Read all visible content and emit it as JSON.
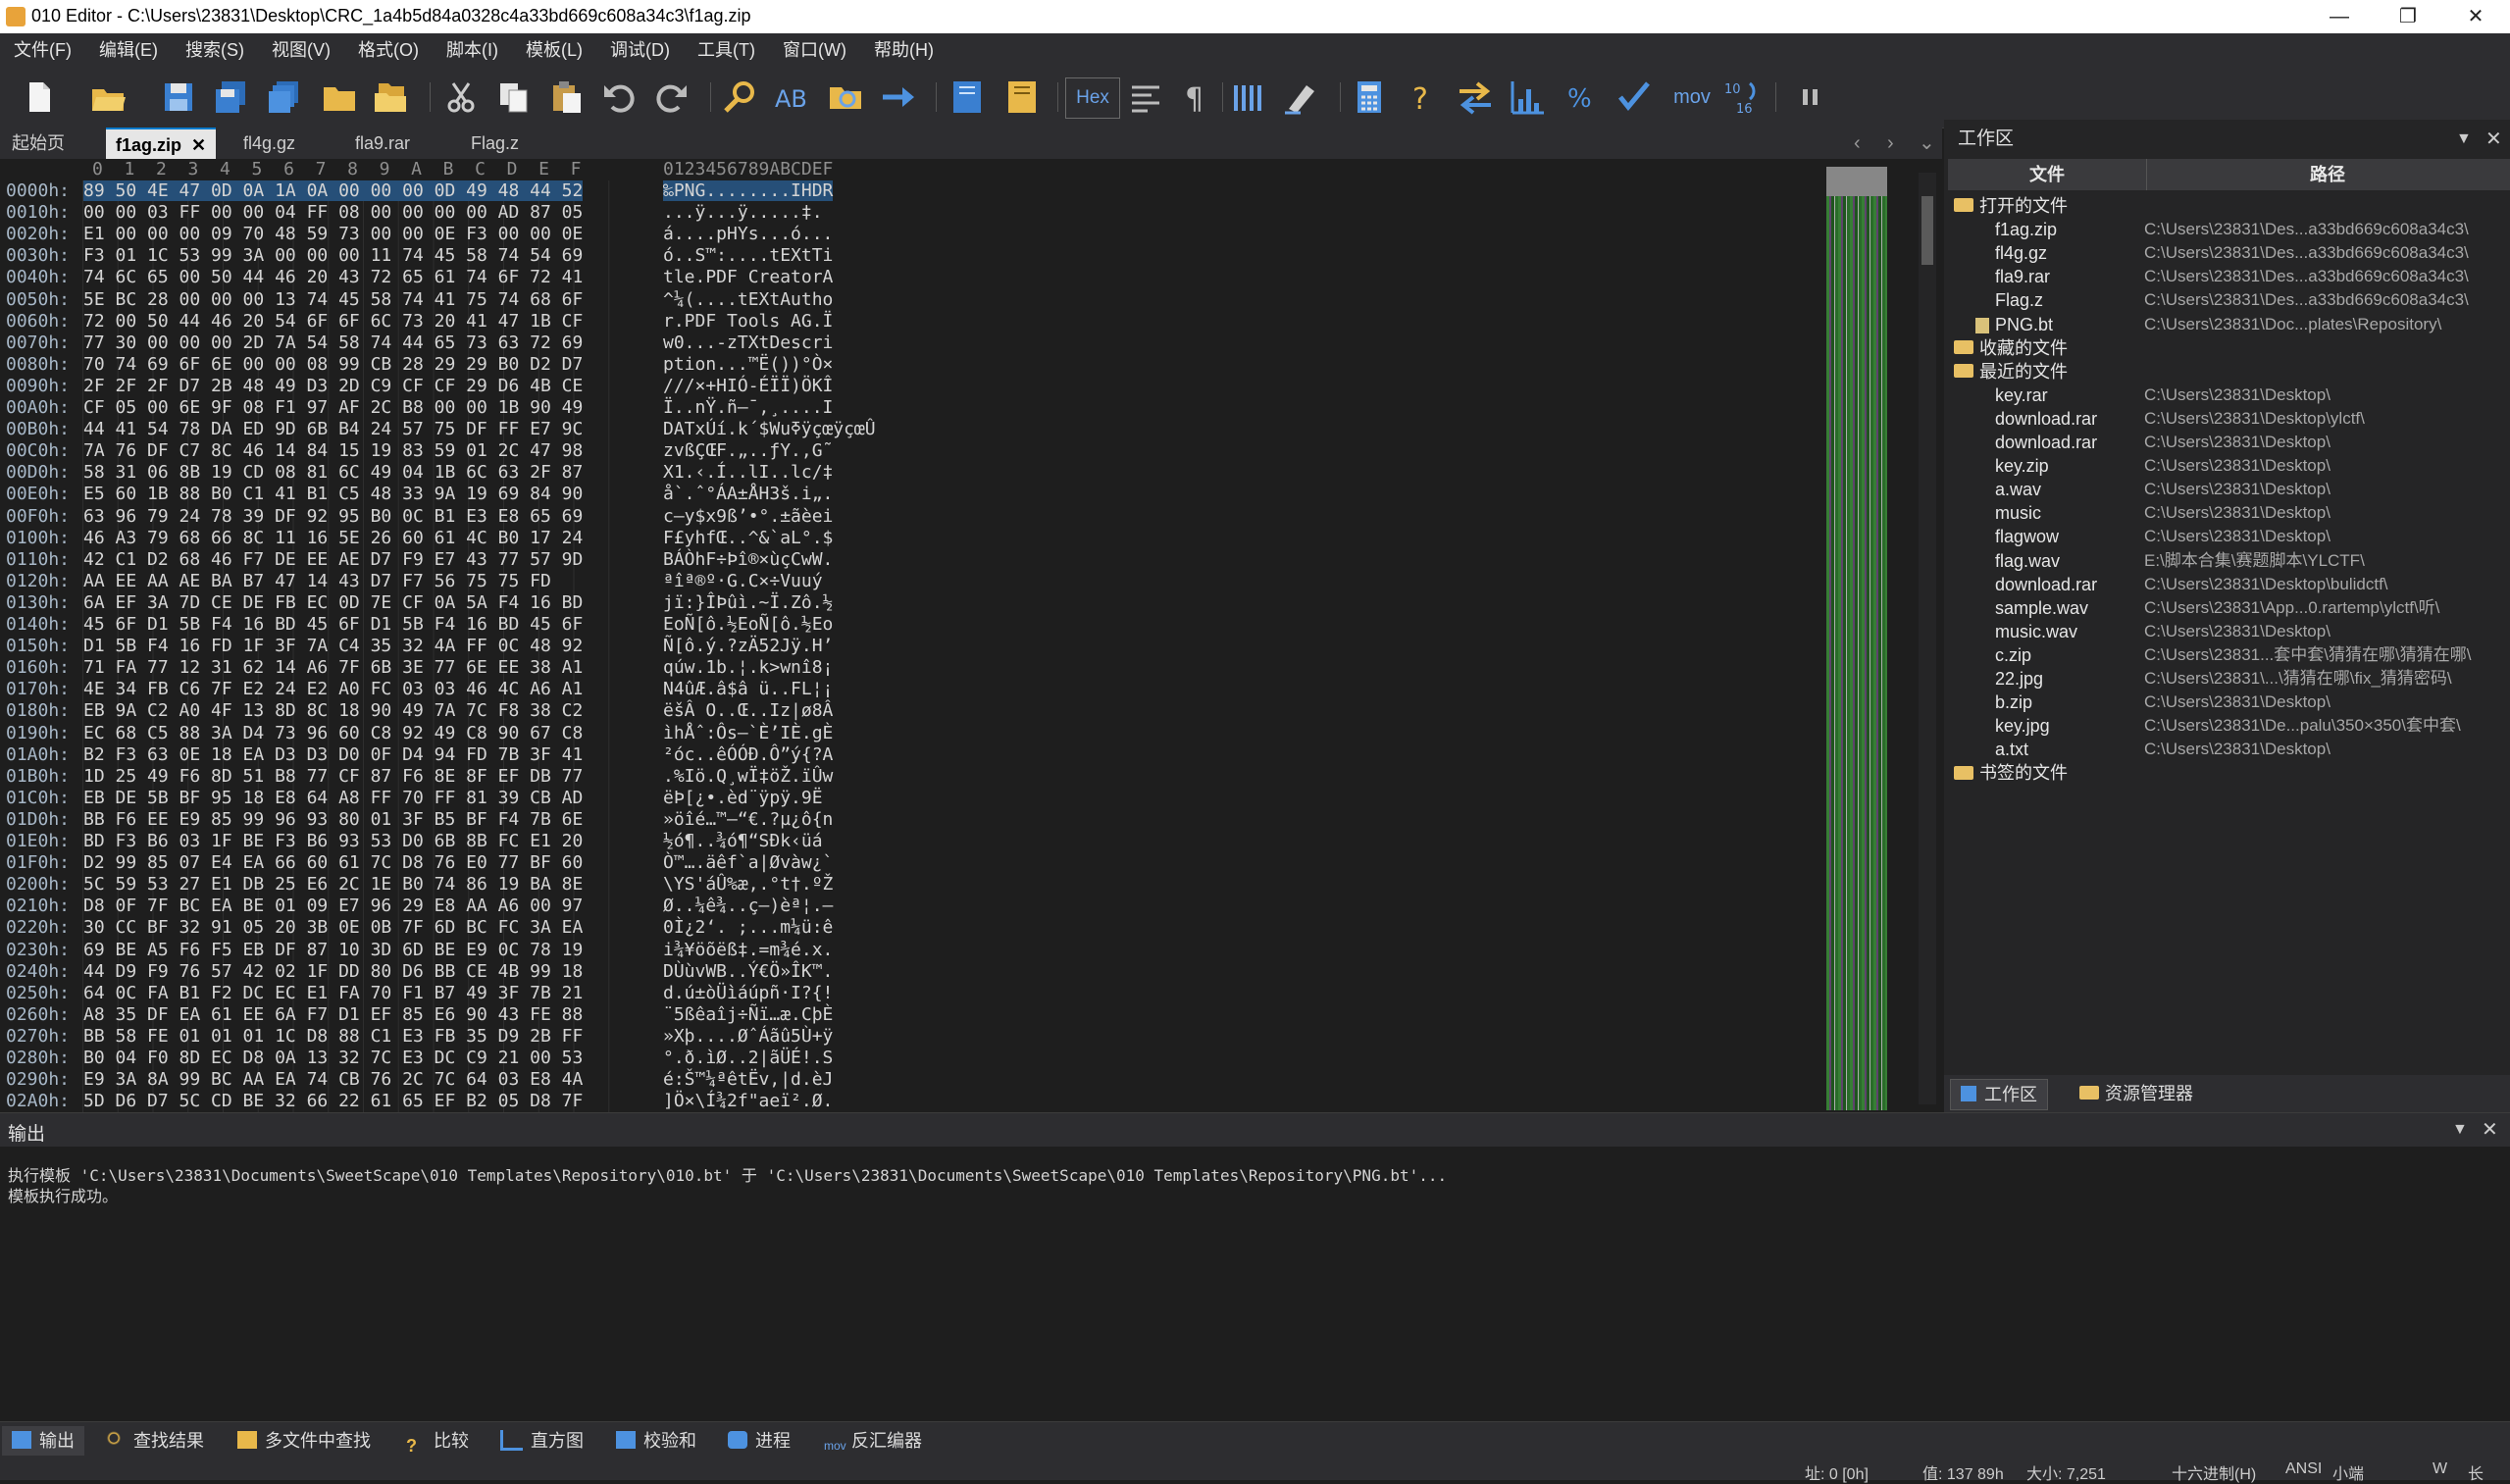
{
  "window": {
    "title": "010 Editor - C:\\Users\\23831\\Desktop\\CRC_1a4b5d84a0328c4a33bd669c608a34c3\\f1ag.zip",
    "minimize": "—",
    "maximize": "❐",
    "close": "✕"
  },
  "menu": [
    "文件(F)",
    "编辑(E)",
    "搜索(S)",
    "视图(V)",
    "格式(O)",
    "脚本(I)",
    "模板(L)",
    "调试(D)",
    "工具(T)",
    "窗口(W)",
    "帮助(H)"
  ],
  "toolbar": {
    "hex_label": "Hex",
    "mov_label": "mov",
    "icons": [
      "new-file-icon",
      "open-file-icon",
      "save-icon",
      "save-as-icon",
      "save-all-icon",
      "open-folder-icon",
      "open-folder-2-icon",
      "cut-icon",
      "copy-icon",
      "paste-icon",
      "undo-icon",
      "redo-icon",
      "find-icon",
      "replace-icon",
      "find-in-files-icon",
      "goto-icon",
      "run-script-icon",
      "run-template-icon",
      "hex-toggle",
      "edit-as-icon",
      "pilcrow-icon",
      "columns-icon",
      "highlight-icon",
      "calculator-icon",
      "help-icon",
      "compare-icon",
      "histogram-icon",
      "percent-icon",
      "checksum-icon",
      "mov-label",
      "base-convert-icon",
      "pause-icon"
    ]
  },
  "tabs": {
    "start": "起始页",
    "files": [
      "f1ag.zip",
      "fl4g.gz",
      "fla9.rar",
      "Flag.z"
    ],
    "active_index": 0,
    "close_glyph": "✕"
  },
  "hex": {
    "col_header": "0  1  2  3  4  5  6  7  8  9  A  B  C  D  E  F",
    "ascii_header": "0123456789ABCDEF",
    "rows": [
      {
        "addr": "0000h:",
        "bytes": "89 50 4E 47 0D 0A 1A 0A 00 00 00 0D 49 48 44 52",
        "ascii": "‰PNG........IHDR"
      },
      {
        "addr": "0010h:",
        "bytes": "00 00 03 FF 00 00 04 FF 08 00 00 00 00 AD 87 05",
        "ascii": "...ÿ...ÿ.....­‡."
      },
      {
        "addr": "0020h:",
        "bytes": "E1 00 00 00 09 70 48 59 73 00 00 0E F3 00 00 0E",
        "ascii": "á....pHYs...ó..."
      },
      {
        "addr": "0030h:",
        "bytes": "F3 01 1C 53 99 3A 00 00 00 11 74 45 58 74 54 69",
        "ascii": "ó..S™:....tEXtTi"
      },
      {
        "addr": "0040h:",
        "bytes": "74 6C 65 00 50 44 46 20 43 72 65 61 74 6F 72 41",
        "ascii": "tle.PDF CreatorA"
      },
      {
        "addr": "0050h:",
        "bytes": "5E BC 28 00 00 00 13 74 45 58 74 41 75 74 68 6F",
        "ascii": "^¼(....tEXtAutho"
      },
      {
        "addr": "0060h:",
        "bytes": "72 00 50 44 46 20 54 6F 6F 6C 73 20 41 47 1B CF",
        "ascii": "r.PDF Tools AG.Ï"
      },
      {
        "addr": "0070h:",
        "bytes": "77 30 00 00 00 2D 7A 54 58 74 44 65 73 63 72 69",
        "ascii": "w0...-zTXtDescri"
      },
      {
        "addr": "0080h:",
        "bytes": "70 74 69 6F 6E 00 00 08 99 CB 28 29 29 B0 D2 D7",
        "ascii": "ption...™Ë())°Ò×"
      },
      {
        "addr": "0090h:",
        "bytes": "2F 2F 2F D7 2B 48 49 D3 2D C9 CF CF 29 D6 4B CE",
        "ascii": "///×+HIÓ-ÉÏÏ)ÖKÎ"
      },
      {
        "addr": "00A0h:",
        "bytes": "CF 05 00 6E 9F 08 F1 97 AF 2C B8 00 00 1B 90 49",
        "ascii": "Ï..nŸ.ñ—¯,¸....I"
      },
      {
        "addr": "00B0h:",
        "bytes": "44 41 54 78 DA ED 9D 6B B4 24 57 75 DF FF E7 9C",
        "ascii": "DATxÚí.k´$WuߧÿçœÿçœÛ"
      },
      {
        "addr": "00C0h:",
        "bytes": "7A 76 DF C7 8C 46 14 84 15 19 83 59 01 2C 47 98",
        "ascii": "zvßÇŒF.„..ƒY.,G˜"
      },
      {
        "addr": "00D0h:",
        "bytes": "58 31 06 8B 19 CD 08 81 6C 49 04 1B 6C 63 2F 87",
        "ascii": "X1.‹.Í..lI..lc/‡"
      },
      {
        "addr": "00E0h:",
        "bytes": "E5 60 1B 88 B0 C1 41 B1 C5 48 33 9A 19 69 84 90",
        "ascii": "å`.ˆ°ÁA±ÅH3š.i„."
      },
      {
        "addr": "00F0h:",
        "bytes": "63 96 79 24 78 39 DF 92 95 B0 0C B1 E3 E8 65 69",
        "ascii": "c–y$x9ß’•°.±ãèei"
      },
      {
        "addr": "0100h:",
        "bytes": "46 A3 79 68 66 8C 11 16 5E 26 60 61 4C B0 17 24",
        "ascii": "F£yhfŒ..^&`aL°.$"
      },
      {
        "addr": "0110h:",
        "bytes": "42 C1 D2 68 46 F7 DE EE AE D7 F9 E7 43 77 57 9D",
        "ascii": "BÁÒhF÷Þî®×ùçCwW."
      },
      {
        "addr": "0120h:",
        "bytes": "AA EE AA AE BA B7 47 14 43 D7 F7 56 75 75 FD",
        "ascii": "ªîª®º·G.C×÷Vuuý"
      },
      {
        "addr": "0130h:",
        "bytes": "6A EF 3A 7D CE DE FB EC 0D 7E CF 0A 5A F4 16 BD",
        "ascii": "jï:}ÎÞûì.~Ï.Zô.½"
      },
      {
        "addr": "0140h:",
        "bytes": "45 6F D1 5B F4 16 BD 45 6F D1 5B F4 16 BD 45 6F",
        "ascii": "EoÑ[ô.½EoÑ[ô.½Eo"
      },
      {
        "addr": "0150h:",
        "bytes": "D1 5B F4 16 FD 1F 3F 7A C4 35 32 4A FF 0C 48 92",
        "ascii": "Ñ[ô.ý.?zÄ52Jÿ.H’"
      },
      {
        "addr": "0160h:",
        "bytes": "71 FA 77 12 31 62 14 A6 7F 6B 3E 77 6E EE 38 A1",
        "ascii": "qúw.1b.¦.k>wnî8¡"
      },
      {
        "addr": "0170h:",
        "bytes": "4E 34 FB C6 7F E2 24 E2 A0 FC 03 03 46 4C A6 A1",
        "ascii": "N4ûÆ.â$â ü..FL¦¡"
      },
      {
        "addr": "0180h:",
        "bytes": "EB 9A C2 A0 4F 13 8D 8C 18 90 49 7A 7C F8 38 C2",
        "ascii": "ëšÂ O..Œ..Iz|ø8Â"
      },
      {
        "addr": "0190h:",
        "bytes": "EC 68 C5 88 3A D4 73 96 60 C8 92 49 C8 90 67 C8",
        "ascii": "ìhÅˆ:Ôs–`È’IÈ.gÈ"
      },
      {
        "addr": "01A0h:",
        "bytes": "B2 F3 63 0E 18 EA D3 D3 D0 0F D4 94 FD 7B 3F 41",
        "ascii": "²óc..êÓÓÐ.Ô”ý{?A"
      },
      {
        "addr": "01B0h:",
        "bytes": "1D 25 49 F6 8D 51 B8 77 CF 87 F6 8E 8F EF DB 77",
        "ascii": ".%Iö.Q¸wÏ‡öŽ.ïÛw"
      },
      {
        "addr": "01C0h:",
        "bytes": "EB DE 5B BF 95 18 E8 64 A8 FF 70 FF 81 39 CB AD",
        "ascii": "ëÞ[¿•.èd¨ÿpÿ.9Ë­"
      },
      {
        "addr": "01D0h:",
        "bytes": "BB F6 EE E9 85 99 96 93 80 01 3F B5 BF F4 7B 6E",
        "ascii": "»öîé…™–“€.?µ¿ô{n"
      },
      {
        "addr": "01E0h:",
        "bytes": "BD F3 B6 03 1F BE F3 B6 93 53 D0 6B 8B FC E1 20",
        "ascii": "½ó¶..¾ó¶“SÐk‹üá "
      },
      {
        "addr": "01F0h:",
        "bytes": "D2 99 85 07 E4 EA 66 60 61 7C D8 76 E0 77 BF 60",
        "ascii": "Ò™….äêf`a|Øvàw¿`"
      },
      {
        "addr": "0200h:",
        "bytes": "5C 59 53 27 E1 DB 25 E6 2C 1E B0 74 86 19 BA 8E",
        "ascii": "\\YS'áÛ%æ,.°t†.ºŽ"
      },
      {
        "addr": "0210h:",
        "bytes": "D8 0F 7F BC EA BE 01 09 E7 96 29 E8 AA A6 00 97",
        "ascii": "Ø..¼ê¾..ç–)èª¦.—"
      },
      {
        "addr": "0220h:",
        "bytes": "30 CC BF 32 91 05 20 3B 0E 0B 7F 6D BC FC 3A EA",
        "ascii": "0Ì¿2‘. ;...m¼ü:ê"
      },
      {
        "addr": "0230h:",
        "bytes": "69 BE A5 F6 F5 EB DF 87 10 3D 6D BE E9 0C 78 19",
        "ascii": "i¾¥öõëß‡.=m¾é.x."
      },
      {
        "addr": "0240h:",
        "bytes": "44 D9 F9 76 57 42 02 1F DD 80 D6 BB CE 4B 99 18",
        "ascii": "DÙùvWB..Ý€Ö»ÎK™."
      },
      {
        "addr": "0250h:",
        "bytes": "64 0C FA B1 F2 DC EC E1 FA 70 F1 B7 49 3F 7B 21",
        "ascii": "d.ú±òÜìáúpñ·I?{!"
      },
      {
        "addr": "0260h:",
        "bytes": "A8 35 DF EA 61 EE 6A F7 D1 EF 85 E6 90 43 FE 88",
        "ascii": "¨5ßêaîj÷Ñï…æ.CþÈ"
      },
      {
        "addr": "0270h:",
        "bytes": "BB 58 FE 01 01 01 1C D8 88 C1 E3 FB 35 D9 2B FF",
        "ascii": "»Xþ....ØˆÁãû5Ù+ÿ"
      },
      {
        "addr": "0280h:",
        "bytes": "B0 04 F0 8D EC D8 0A 13 32 7C E3 DC C9 21 00 53",
        "ascii": "°.ð.ìØ..2|ãÜÉ!.S"
      },
      {
        "addr": "0290h:",
        "bytes": "E9 3A 8A 99 BC AA EA 74 CB 76 2C 7C 64 03 E8 4A",
        "ascii": "é:Š™¼ªêtËv,|d.èJ"
      },
      {
        "addr": "02A0h:",
        "bytes": "5D D6 D7 5C CD BE 32 66 22 61 65 EF B2 05 D8 7F",
        "ascii": "]Ö×\\Í¾2f\"aeï².Ø."
      }
    ]
  },
  "workspace": {
    "title": "工作区",
    "col_file": "文件",
    "col_path": "路径",
    "groups": {
      "open": "打开的文件",
      "favorites": "收藏的文件",
      "recent": "最近的文件",
      "bookmarked": "书签的文件"
    },
    "open_files": [
      {
        "name": "f1ag.zip",
        "path": "C:\\Users\\23831\\Des...a33bd669c608a34c3\\"
      },
      {
        "name": "fl4g.gz",
        "path": "C:\\Users\\23831\\Des...a33bd669c608a34c3\\"
      },
      {
        "name": "fla9.rar",
        "path": "C:\\Users\\23831\\Des...a33bd669c608a34c3\\"
      },
      {
        "name": "Flag.z",
        "path": "C:\\Users\\23831\\Des...a33bd669c608a34c3\\"
      },
      {
        "name": "PNG.bt",
        "path": "C:\\Users\\23831\\Doc...plates\\Repository\\"
      }
    ],
    "recent_files": [
      {
        "name": "key.rar",
        "path": "C:\\Users\\23831\\Desktop\\"
      },
      {
        "name": "download.rar",
        "path": "C:\\Users\\23831\\Desktop\\ylctf\\"
      },
      {
        "name": "download.rar",
        "path": "C:\\Users\\23831\\Desktop\\"
      },
      {
        "name": "key.zip",
        "path": "C:\\Users\\23831\\Desktop\\"
      },
      {
        "name": "a.wav",
        "path": "C:\\Users\\23831\\Desktop\\"
      },
      {
        "name": "music",
        "path": "C:\\Users\\23831\\Desktop\\"
      },
      {
        "name": "flagwow",
        "path": "C:\\Users\\23831\\Desktop\\"
      },
      {
        "name": "flag.wav",
        "path": "E:\\脚本合集\\赛题脚本\\YLCTF\\"
      },
      {
        "name": "download.rar",
        "path": "C:\\Users\\23831\\Desktop\\bulidctf\\"
      },
      {
        "name": "sample.wav",
        "path": "C:\\Users\\23831\\App...0.rartemp\\ylctf\\听\\"
      },
      {
        "name": "music.wav",
        "path": "C:\\Users\\23831\\Desktop\\"
      },
      {
        "name": "c.zip",
        "path": "C:\\Users\\23831...套中套\\猜猜在哪\\猜猜在哪\\"
      },
      {
        "name": "22.jpg",
        "path": "C:\\Users\\23831\\...\\猜猜在哪\\fix_猜猜密码\\"
      },
      {
        "name": "b.zip",
        "path": "C:\\Users\\23831\\Desktop\\"
      },
      {
        "name": "key.jpg",
        "path": "C:\\Users\\23831\\De...palu\\350×350\\套中套\\"
      },
      {
        "name": "a.txt",
        "path": "C:\\Users\\23831\\Desktop\\"
      }
    ],
    "bottom_tabs": [
      "工作区",
      "资源管理器"
    ]
  },
  "output": {
    "title": "输出",
    "lines": [
      "执行模板 'C:\\Users\\23831\\Documents\\SweetScape\\010 Templates\\Repository\\010.bt' 于 'C:\\Users\\23831\\Documents\\SweetScape\\010 Templates\\Repository\\PNG.bt'...",
      "模板执行成功。"
    ]
  },
  "bottom_tabs": [
    "输出",
    "查找结果",
    "多文件中查找",
    "比较",
    "直方图",
    "校验和",
    "进程",
    "反汇编器"
  ],
  "status": {
    "pos": "址: 0 [0h]",
    "val": "值: 137 89h",
    "size": "大小: 7,251",
    "mode": "十六进制(H)",
    "encoding": "ANSI",
    "endian": "小端",
    "ins": "W",
    "ovr": "长"
  },
  "colors": {
    "accent": "#007acc",
    "background": "#1e1e1e",
    "panel": "#2d2d30",
    "selection": "#264f78"
  }
}
